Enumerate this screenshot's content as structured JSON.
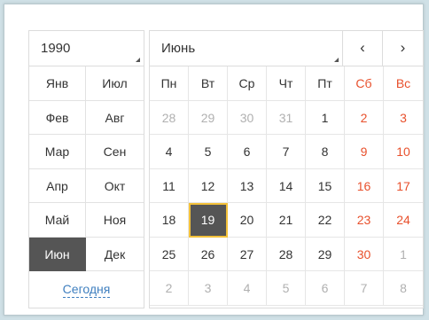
{
  "year": "1990",
  "month": "Июнь",
  "nav": {
    "prev": "‹",
    "next": "›"
  },
  "months": [
    "Янв",
    "Июл",
    "Фев",
    "Авг",
    "Мар",
    "Сен",
    "Апр",
    "Окт",
    "Май",
    "Ноя",
    "Июн",
    "Дек"
  ],
  "selected_month": "Июн",
  "today_label": "Сегодня",
  "weekdays": [
    "Пн",
    "Вт",
    "Ср",
    "Чт",
    "Пт",
    "Сб",
    "Вс"
  ],
  "days": [
    [
      "28",
      "other"
    ],
    [
      "29",
      "other"
    ],
    [
      "30",
      "other"
    ],
    [
      "31",
      "other"
    ],
    [
      "1",
      "wk"
    ],
    [
      "2",
      "we"
    ],
    [
      "3",
      "we"
    ],
    [
      "4",
      "wk"
    ],
    [
      "5",
      "wk"
    ],
    [
      "6",
      "wk"
    ],
    [
      "7",
      "wk"
    ],
    [
      "8",
      "wk"
    ],
    [
      "9",
      "we"
    ],
    [
      "10",
      "we"
    ],
    [
      "11",
      "wk"
    ],
    [
      "12",
      "wk"
    ],
    [
      "13",
      "wk"
    ],
    [
      "14",
      "wk"
    ],
    [
      "15",
      "wk"
    ],
    [
      "16",
      "we"
    ],
    [
      "17",
      "we"
    ],
    [
      "18",
      "wk"
    ],
    [
      "19",
      "sel-day"
    ],
    [
      "20",
      "wk"
    ],
    [
      "21",
      "wk"
    ],
    [
      "22",
      "wk"
    ],
    [
      "23",
      "we"
    ],
    [
      "24",
      "we"
    ],
    [
      "25",
      "wk"
    ],
    [
      "26",
      "wk"
    ],
    [
      "27",
      "wk"
    ],
    [
      "28",
      "wk"
    ],
    [
      "29",
      "wk"
    ],
    [
      "30",
      "we"
    ],
    [
      "1",
      "other"
    ],
    [
      "2",
      "other"
    ],
    [
      "3",
      "other"
    ],
    [
      "4",
      "other"
    ],
    [
      "5",
      "other"
    ],
    [
      "6",
      "other"
    ],
    [
      "7",
      "other"
    ],
    [
      "8",
      "other"
    ]
  ],
  "colors": {
    "weekend": "#e8502c",
    "selected_bg": "#555555",
    "selected_outline": "#f3c13a",
    "link": "#3f7fbf"
  }
}
